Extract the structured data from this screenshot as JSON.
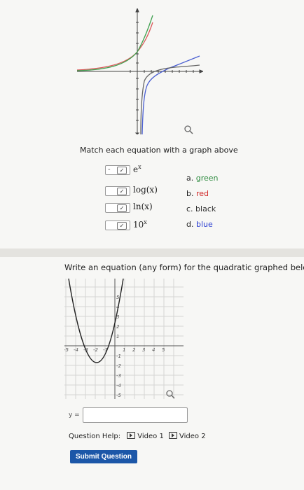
{
  "part1": {
    "instruction": "Match each equation with a graph above",
    "rows": [
      {
        "selected": "-",
        "equation": "e"
      },
      {
        "selected": "",
        "equation": "log(x)"
      },
      {
        "selected": "",
        "equation": "ln(x)"
      },
      {
        "selected": "",
        "equation": "10"
      }
    ],
    "exp1": "x",
    "exp4": "x",
    "options": [
      {
        "letter": "a.",
        "color_name": "green",
        "color": "#2e8b3f"
      },
      {
        "letter": "b.",
        "color_name": "red",
        "color": "#d12a2a"
      },
      {
        "letter": "c.",
        "color_name": "black",
        "color": "#333333"
      },
      {
        "letter": "d.",
        "color_name": "blue",
        "color": "#2a3dd1"
      }
    ],
    "magnify_icon": "magnifier-icon",
    "curve_colors": {
      "green": "#3fa04f",
      "red": "#d95a5a",
      "black": "#666666",
      "blue": "#4a5fd1"
    }
  },
  "part2": {
    "instruction": "Write an equation (any form) for the quadratic graphed below",
    "x_ticks": [
      "-5",
      "-4",
      "-3",
      "-2",
      "-1",
      "1",
      "2",
      "3",
      "4",
      "5"
    ],
    "y_ticks": [
      "5",
      "4",
      "3",
      "2",
      "1",
      "-1",
      "-2",
      "-3",
      "-4",
      "-5"
    ],
    "answer_label": "y =",
    "answer_value": "",
    "question_help_label": "Question Help:",
    "video1_label": "Video 1",
    "video2_label": "Video 2",
    "submit_label": "Submit Question",
    "magnify_icon": "magnifier-icon"
  }
}
